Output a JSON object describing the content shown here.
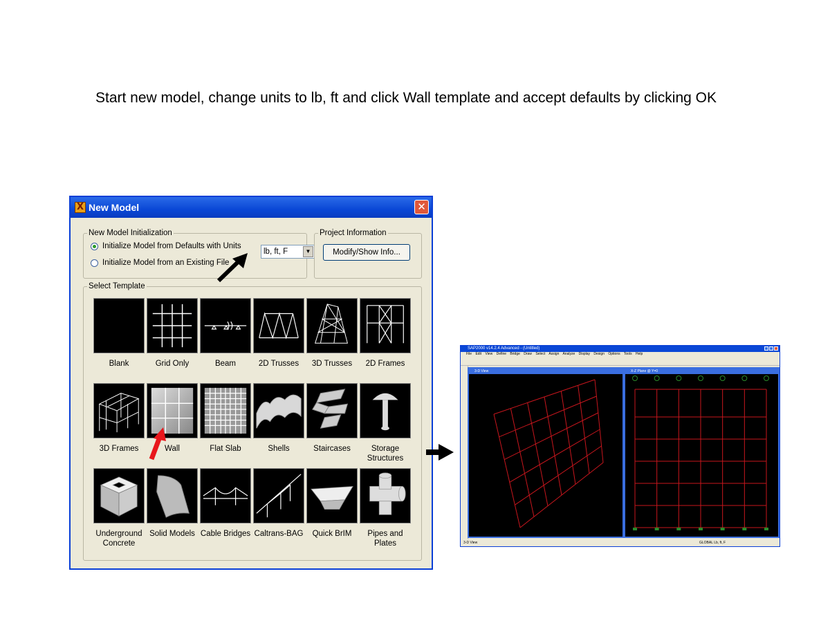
{
  "instruction": "Start new model, change units to lb, ft and click Wall template and accept defaults by clicking OK",
  "dialog": {
    "title": "New Model",
    "init_group": "New Model Initialization",
    "radio_defaults": "Initialize Model from Defaults with Units",
    "radio_file": "Initialize Model from an Existing File",
    "units_value": "lb, ft, F",
    "project_group": "Project Information",
    "modify_button": "Modify/Show Info...",
    "template_group": "Select Template",
    "templates": [
      {
        "label": "Blank"
      },
      {
        "label": "Grid Only"
      },
      {
        "label": "Beam"
      },
      {
        "label": "2D Trusses"
      },
      {
        "label": "3D Trusses"
      },
      {
        "label": "2D Frames"
      },
      {
        "label": "3D Frames"
      },
      {
        "label": "Wall"
      },
      {
        "label": "Flat Slab"
      },
      {
        "label": "Shells"
      },
      {
        "label": "Staircases"
      },
      {
        "label": "Storage Structures"
      },
      {
        "label": "Underground Concrete"
      },
      {
        "label": "Solid Models"
      },
      {
        "label": "Cable Bridges"
      },
      {
        "label": "Caltrans-BAG"
      },
      {
        "label": "Quick BrIM"
      },
      {
        "label": "Pipes and Plates"
      }
    ]
  },
  "sap": {
    "title": "SAP2000 v14.2.4 Advanced - (Untitled)",
    "menu": "File Edit View Define Bridge Draw Select Assign Analyze Display Design Options Tools Help",
    "pane_3d_title": "3-D View",
    "pane_xz_title": "X-Z Plane @ Y=0",
    "status_left": "3-D View",
    "status_right": "GLOBAL Lb, ft, F"
  },
  "colors": {
    "accent": "#0A47D6",
    "grid": "#C8161D",
    "arrow_red": "#E8161B"
  }
}
